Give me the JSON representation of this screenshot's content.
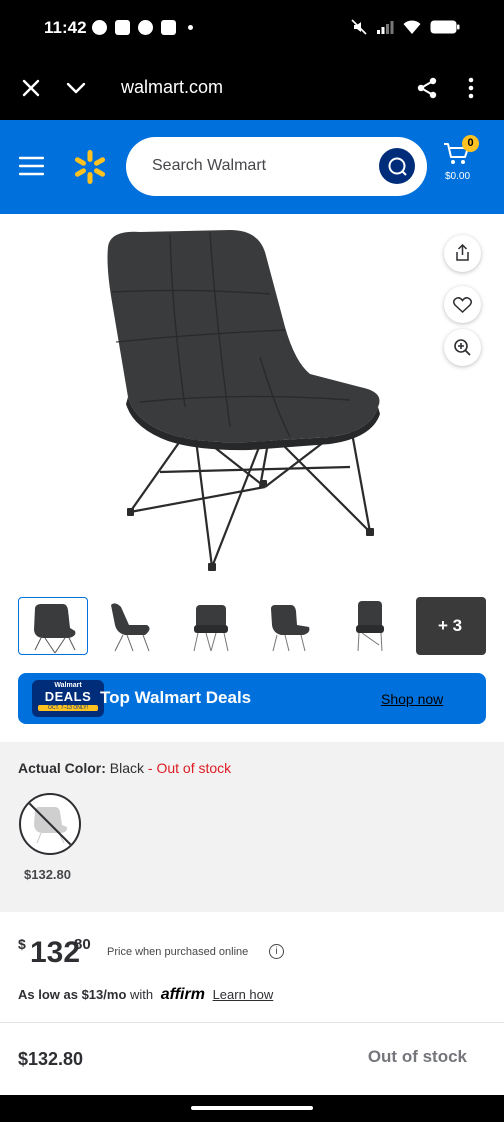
{
  "status_bar": {
    "time": "11:42",
    "notification_icons": [
      "messenger-icon",
      "discord-icon",
      "chat-icon",
      "app-icon"
    ],
    "system_icons": [
      "mute-icon",
      "signal-icon",
      "wifi-icon",
      "battery-icon"
    ]
  },
  "browser": {
    "url": "walmart.com"
  },
  "header": {
    "search_placeholder": "Search Walmart",
    "cart_count": "0",
    "cart_amount": "$0.00",
    "brand_color": "#0071dc",
    "spark_color": "#ffc220"
  },
  "thumbnails": {
    "count_visible": 5,
    "more_label": "+ 3"
  },
  "deals_banner": {
    "logo_line1": "Walmart",
    "logo_line2": "DEALS",
    "logo_line3": "OCT. 7–13 ONLY!",
    "title": "Top Walmart Deals",
    "link": "Shop now"
  },
  "variant": {
    "label": "Actual Color:",
    "value": "Black",
    "separator": " - ",
    "status": "Out of stock",
    "swatch_price": "$132.80"
  },
  "price": {
    "currency": "$",
    "dollars": "132",
    "cents": "80",
    "note": "Price when purchased online",
    "info_icon": "i"
  },
  "affirm": {
    "text_bold": "As low as $13/mo",
    "text_with": "with",
    "brand": "affirm",
    "link": "Learn how"
  },
  "bottom_bar": {
    "price": "$132.80",
    "status": "Out of stock"
  }
}
